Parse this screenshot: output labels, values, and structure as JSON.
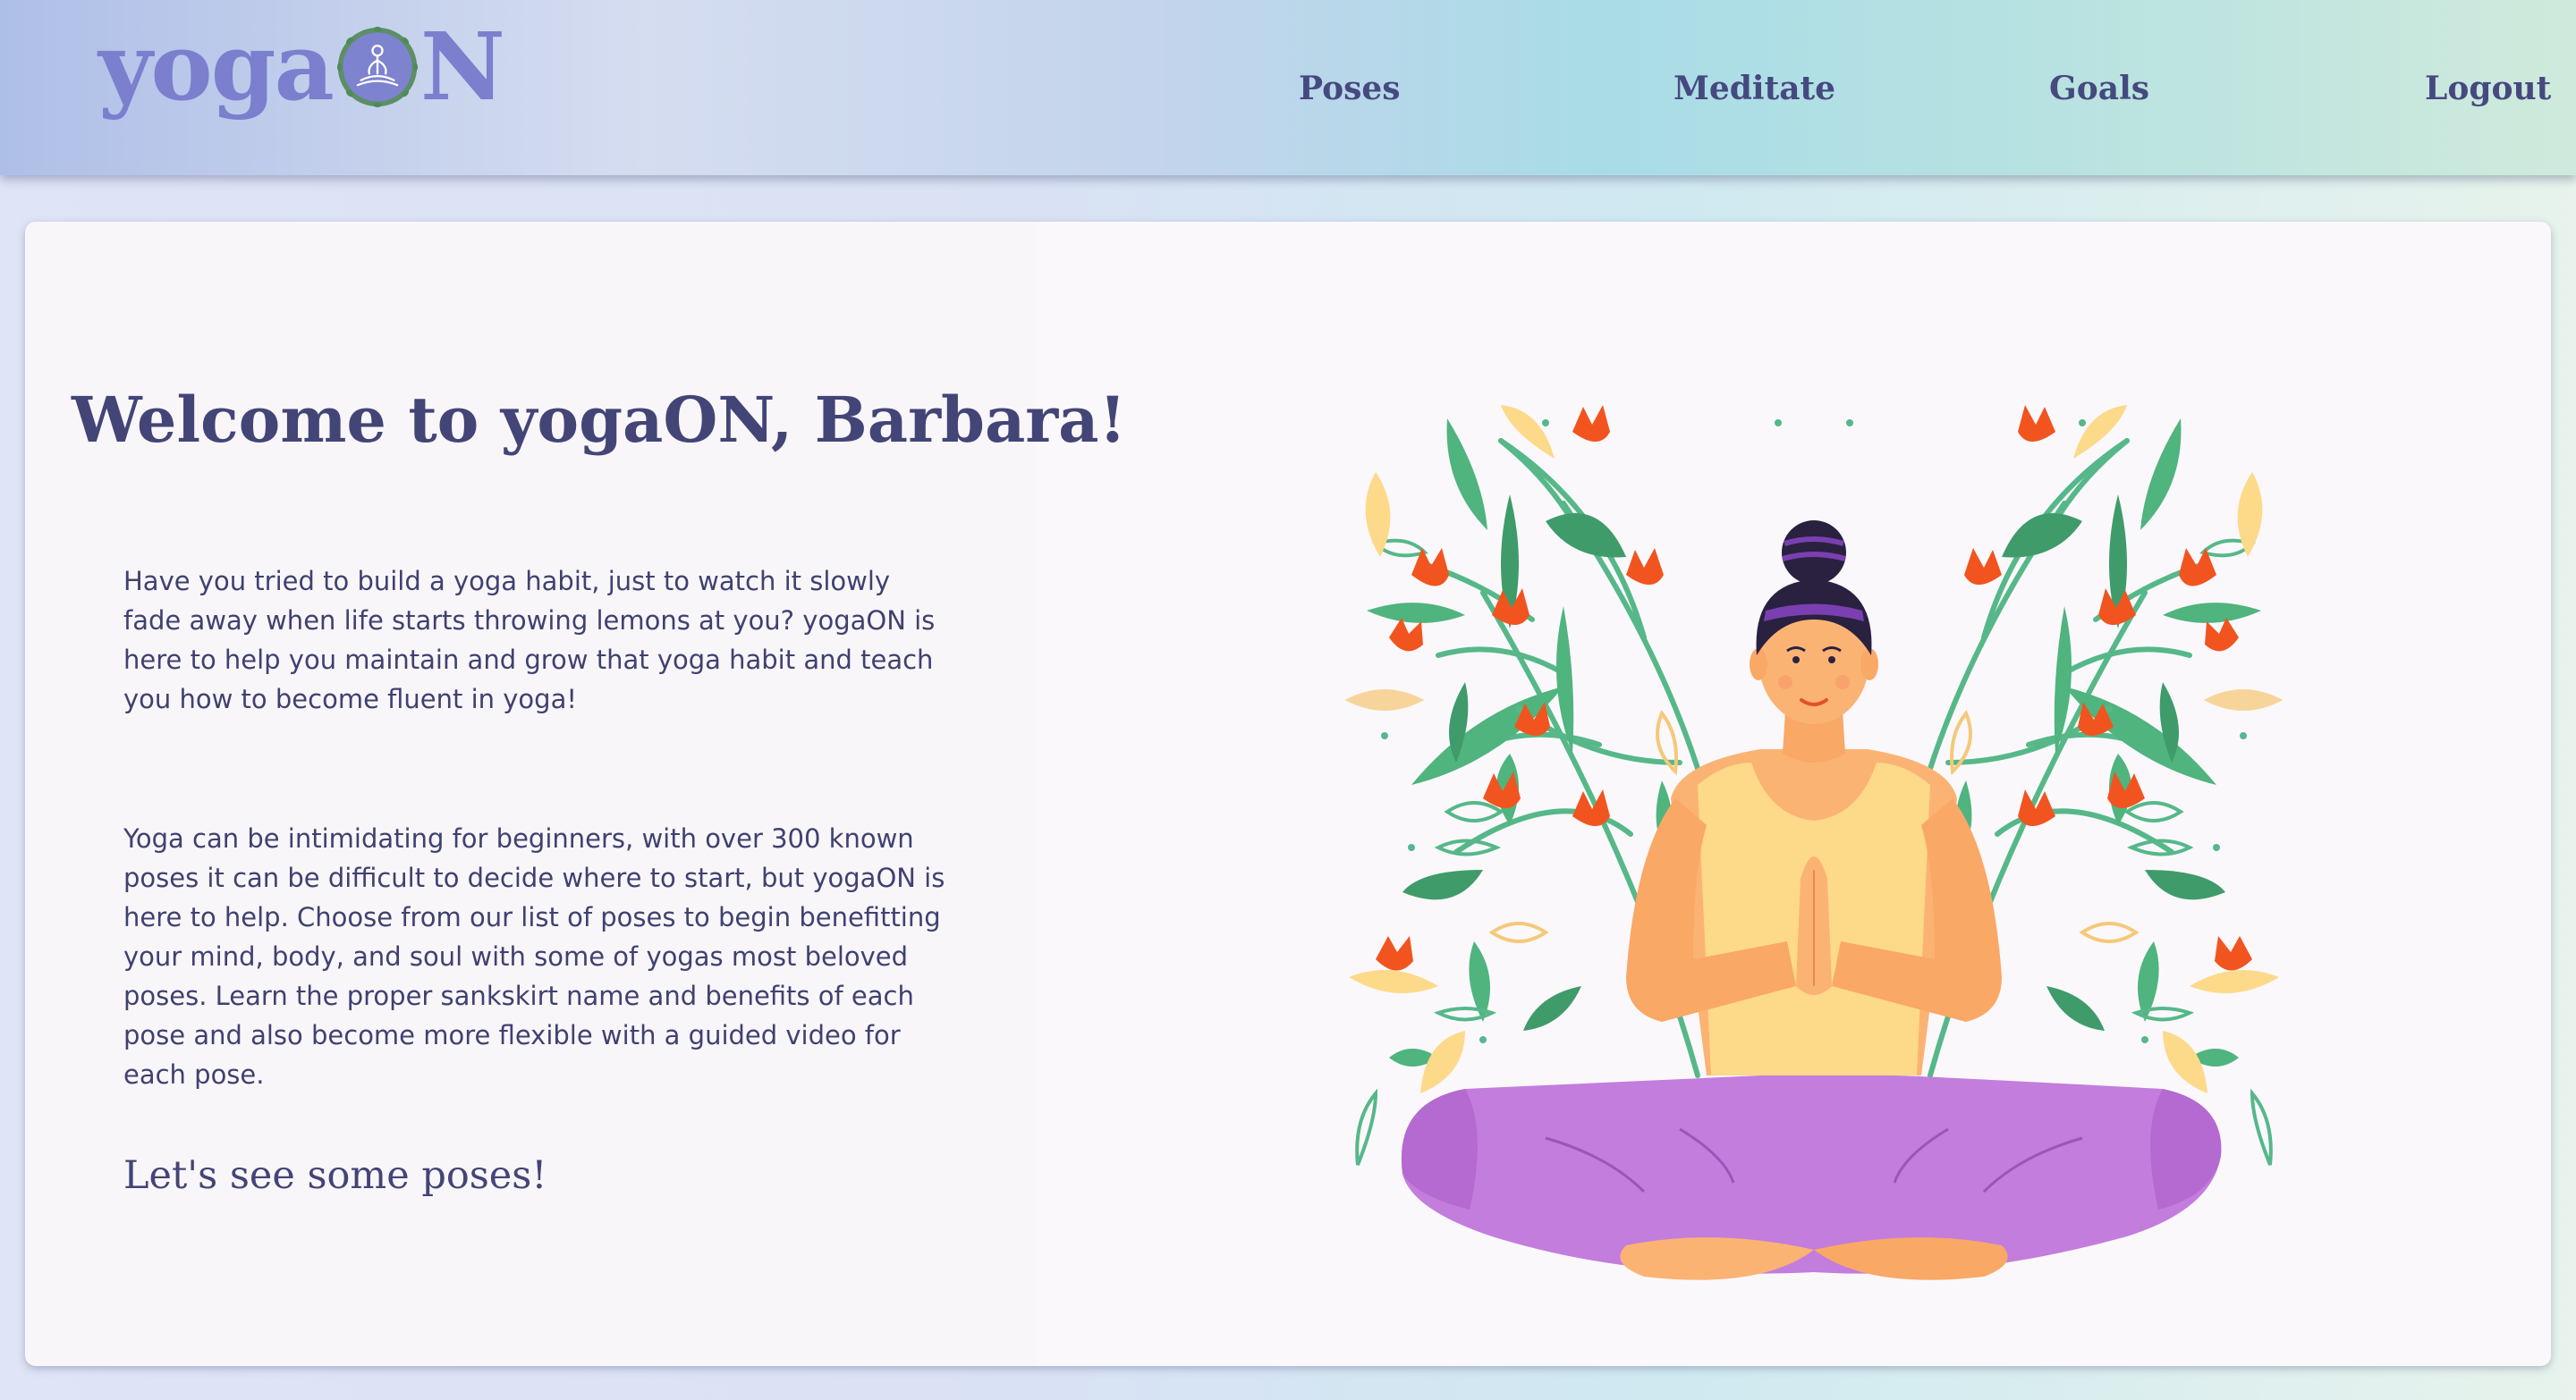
{
  "header": {
    "logo": {
      "text_left": "yoga",
      "text_right": "N",
      "color": "#7b7fce"
    },
    "nav": [
      {
        "label": "Poses"
      },
      {
        "label": "Meditate"
      },
      {
        "label": "Goals"
      },
      {
        "label": "Logout"
      }
    ]
  },
  "main": {
    "welcome": "Welcome to yogaON, Barbara!",
    "paragraph1": "Have you tried to build a yoga habit, just to watch it slowly fade away when life starts throwing lemons at you? yogaON is here to help you maintain and grow that yoga habit and teach you how to become fluent in yoga!",
    "paragraph2": "Yoga can be intimidating for beginners, with over 300 known poses it can be difficult to decide where to start, but yogaON is here to help. Choose from our list of poses to begin benefitting your mind, body, and soul with some of yogas most beloved poses. Learn the proper sankskirt name and benefits of each pose and also become more flexible with a guided video for each pose.",
    "cta": "Let's see some poses!"
  },
  "illustration": {
    "icon": "meditating-woman-illustration",
    "colors": {
      "leaf": "#4fb47e",
      "flower": "#f2541f",
      "pants": "#c27ddd",
      "top": "#fdd98a",
      "skin": "#fbb374",
      "hair": "#2a2140"
    }
  }
}
